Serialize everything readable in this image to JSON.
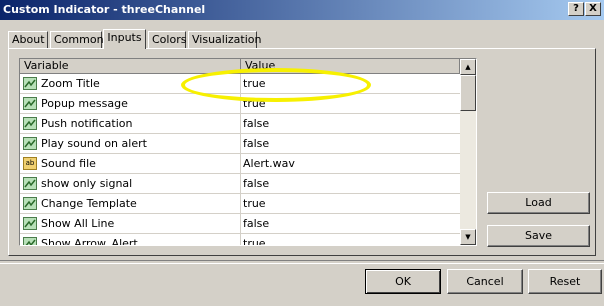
{
  "window": {
    "title": "Custom Indicator - threeChannel",
    "help_label": "?",
    "close_label": "X"
  },
  "tabs": [
    {
      "label": "About"
    },
    {
      "label": "Common"
    },
    {
      "label": "Inputs"
    },
    {
      "label": "Colors"
    },
    {
      "label": "Visualization"
    }
  ],
  "grid": {
    "headers": {
      "variable": "Variable",
      "value": "Value"
    },
    "rows": [
      {
        "variable": "Zoom Title",
        "value": "true",
        "type": "bool-icon"
      },
      {
        "variable": "Popup message",
        "value": "true",
        "type": "bool-icon"
      },
      {
        "variable": "Push notification",
        "value": "false",
        "type": "bool-icon"
      },
      {
        "variable": "Play sound on alert",
        "value": "false",
        "type": "bool-icon"
      },
      {
        "variable": "Sound file",
        "value": "Alert.wav",
        "type": "string-icon",
        "icon_text": "ab"
      },
      {
        "variable": "show only signal",
        "value": "false",
        "type": "bool-icon"
      },
      {
        "variable": "Change Template",
        "value": "true",
        "type": "bool-icon"
      },
      {
        "variable": "Show All Line",
        "value": "false",
        "type": "bool-icon"
      },
      {
        "variable": "Show Arrow_Alert",
        "value": "true",
        "type": "bool-icon"
      }
    ]
  },
  "side_buttons": {
    "load": "Load",
    "save": "Save"
  },
  "footer_buttons": {
    "ok": "OK",
    "cancel": "Cancel",
    "reset": "Reset"
  },
  "colors": {
    "highlight_circle": "#f7f000",
    "titlebar": "#0a246a"
  }
}
